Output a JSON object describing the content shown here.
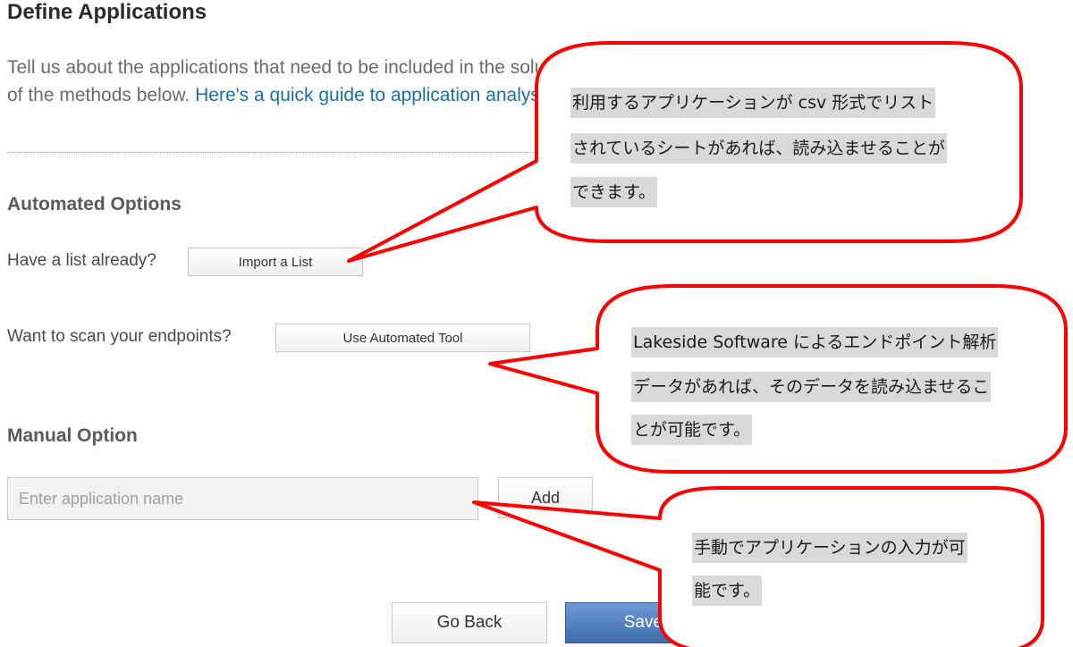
{
  "page": {
    "title": "Define Applications",
    "intro_text": "Tell us about the applications that need to be included in the solution. Enter apps by using one of the methods below. ",
    "intro_link": "Here's a quick guide to application analysis"
  },
  "automated": {
    "title": "Automated Options",
    "list_label": "Have a list already?",
    "import_button": "Import a List",
    "scan_label": "Want to scan your endpoints?",
    "tool_button": "Use Automated Tool"
  },
  "manual": {
    "title": "Manual Option",
    "input_placeholder": "Enter application name",
    "add_button": "Add"
  },
  "footer": {
    "back_button": "Go Back",
    "save_button": "Save & Continue"
  },
  "callouts": [
    {
      "lines": [
        "利用するアプリケーションが csv 形式でリスト",
        "されているシートがあれば、読み込ませることが",
        "できます。"
      ]
    },
    {
      "lines": [
        "Lakeside Software によるエンドポイント解析",
        "データがあれば、そのデータを読み込ませるこ",
        "とが可能です。"
      ]
    },
    {
      "lines": [
        "手動でアプリケーションの入力が可",
        "能です。"
      ]
    }
  ],
  "colors": {
    "callout_border": "#ff0000",
    "link": "#1a6fa8",
    "primary_button": "#3d6bb0"
  }
}
